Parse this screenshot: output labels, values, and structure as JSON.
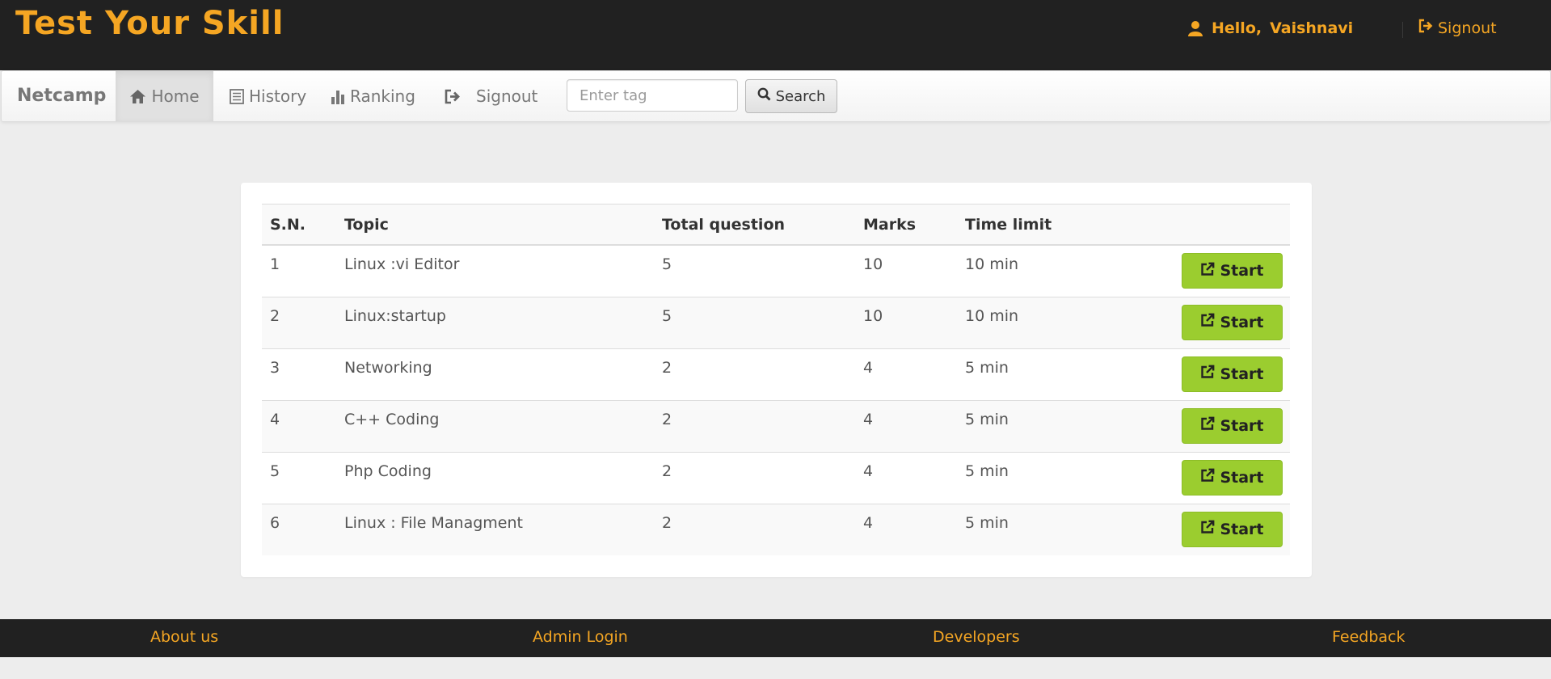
{
  "header": {
    "brand": "Test Your Skill",
    "greeting": "Hello,",
    "username": "Vaishnavi",
    "signout_label": "Signout"
  },
  "navbar": {
    "brand": "Netcamp",
    "items": [
      {
        "label": "Home",
        "icon": "home-icon",
        "active": true
      },
      {
        "label": "History",
        "icon": "list-icon"
      },
      {
        "label": "Ranking",
        "icon": "bar-chart-icon"
      },
      {
        "label": "Signout",
        "icon": "signout-icon"
      }
    ],
    "search": {
      "placeholder": "Enter tag",
      "value": "",
      "button_label": "Search"
    }
  },
  "table": {
    "columns": [
      "S.N.",
      "Topic",
      "Total question",
      "Marks",
      "Time limit"
    ],
    "start_label": "Start",
    "rows": [
      {
        "sn": "1",
        "topic": "Linux :vi Editor",
        "total": "5",
        "marks": "10",
        "time": "10 min"
      },
      {
        "sn": "2",
        "topic": "Linux:startup",
        "total": "5",
        "marks": "10",
        "time": "10 min"
      },
      {
        "sn": "3",
        "topic": "Networking",
        "total": "2",
        "marks": "4",
        "time": "5 min"
      },
      {
        "sn": "4",
        "topic": "C++ Coding",
        "total": "2",
        "marks": "4",
        "time": "5 min"
      },
      {
        "sn": "5",
        "topic": "Php Coding",
        "total": "2",
        "marks": "4",
        "time": "5 min"
      },
      {
        "sn": "6",
        "topic": "Linux : File Managment",
        "total": "2",
        "marks": "4",
        "time": "5 min"
      }
    ]
  },
  "footer": {
    "links": [
      "About us",
      "Admin Login",
      "Developers",
      "Feedback"
    ]
  },
  "colors": {
    "accent": "#f5a623",
    "header_bg": "#212121",
    "start_button": "#9bcd2f",
    "page_bg": "#ededed"
  }
}
